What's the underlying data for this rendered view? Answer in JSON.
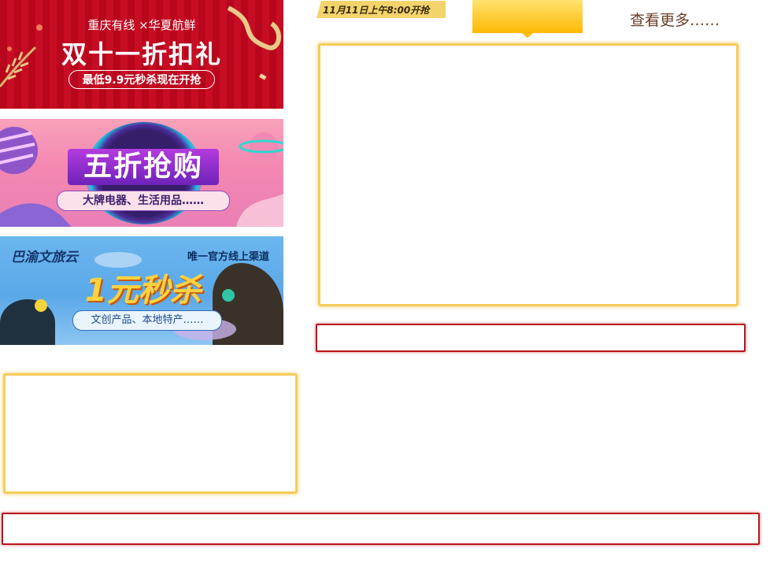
{
  "banners": [
    {
      "line1": "重庆有线 ×华夏航鲜",
      "title": "双十一折扣礼",
      "pill": "最低9.9元秒杀现在开抢"
    },
    {
      "title": "五折抢购",
      "pill": "大牌电器、生活用品……"
    },
    {
      "logo": "巴渝文旅云",
      "top": "唯一官方线上渠道",
      "title": "1元秒杀",
      "pill": "文创产品、本地特产……"
    }
  ],
  "tag_label": "11月11日上午8:00开抢",
  "see_more": "查看更多……",
  "colors": {
    "gold": "#f5cc5a",
    "red": "#b9141b",
    "yellow_tab": "#fdb900"
  }
}
